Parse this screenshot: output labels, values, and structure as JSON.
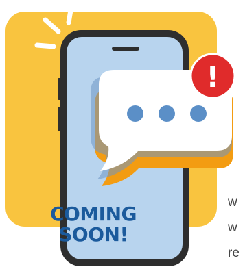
{
  "illustration": {
    "phone_message_line1": "COMING",
    "phone_message_line2": "SOON!",
    "alert_symbol": "!",
    "icons": [
      "phone-icon",
      "chat-bubble-icon",
      "typing-dots-icon",
      "alert-badge-icon",
      "shine-lines-icon"
    ]
  },
  "side_text": {
    "lines": [
      "w",
      "w",
      "re"
    ]
  },
  "colors": {
    "backdrop_yellow": "#f9c43f",
    "phone_frame": "#2e2e2e",
    "screen_blue": "#b8d4ee",
    "bubble_white": "#ffffff",
    "dots_blue": "#5b8fc7",
    "alert_red": "#e02b2b",
    "text_blue": "#1b5a9c",
    "accent_orange": "#f39c12"
  }
}
